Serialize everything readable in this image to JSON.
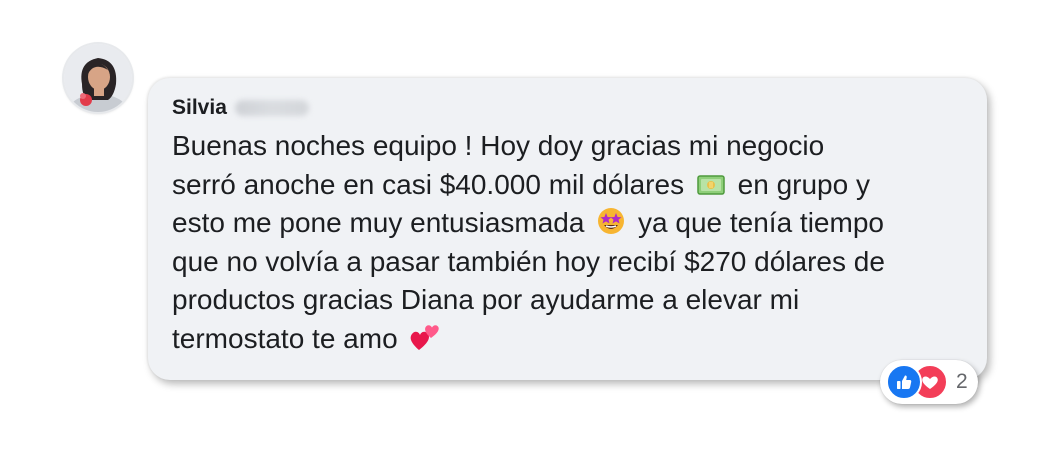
{
  "comment": {
    "author": {
      "first_name": "Silvia"
    },
    "lines": [
      {
        "text": "Buenas noches equipo ! Hoy doy gracias mi negocio"
      },
      {
        "text": "serró anoche en casi $40.000 mil dólares",
        "emoji": "money-bill-emoji",
        "after": "en grupo y"
      },
      {
        "text": "esto me pone muy entusiasmada",
        "emoji": "star-struck-emoji",
        "after": "ya que tenía tiempo"
      },
      {
        "text": "que no volvía a pasar también hoy recibí $270 dólares de"
      },
      {
        "text": "productos gracias Diana por ayudarme a elevar mi"
      },
      {
        "text": "termostato te amo",
        "emoji": "two-hearts-emoji"
      }
    ],
    "reactions": {
      "icons": [
        "like-icon",
        "love-icon"
      ],
      "count": "2"
    }
  },
  "colors": {
    "bubble": "#f0f2f5",
    "text": "#1c1e21",
    "like": "#1877f2",
    "love": "#f33e58",
    "count": "#65676b"
  }
}
